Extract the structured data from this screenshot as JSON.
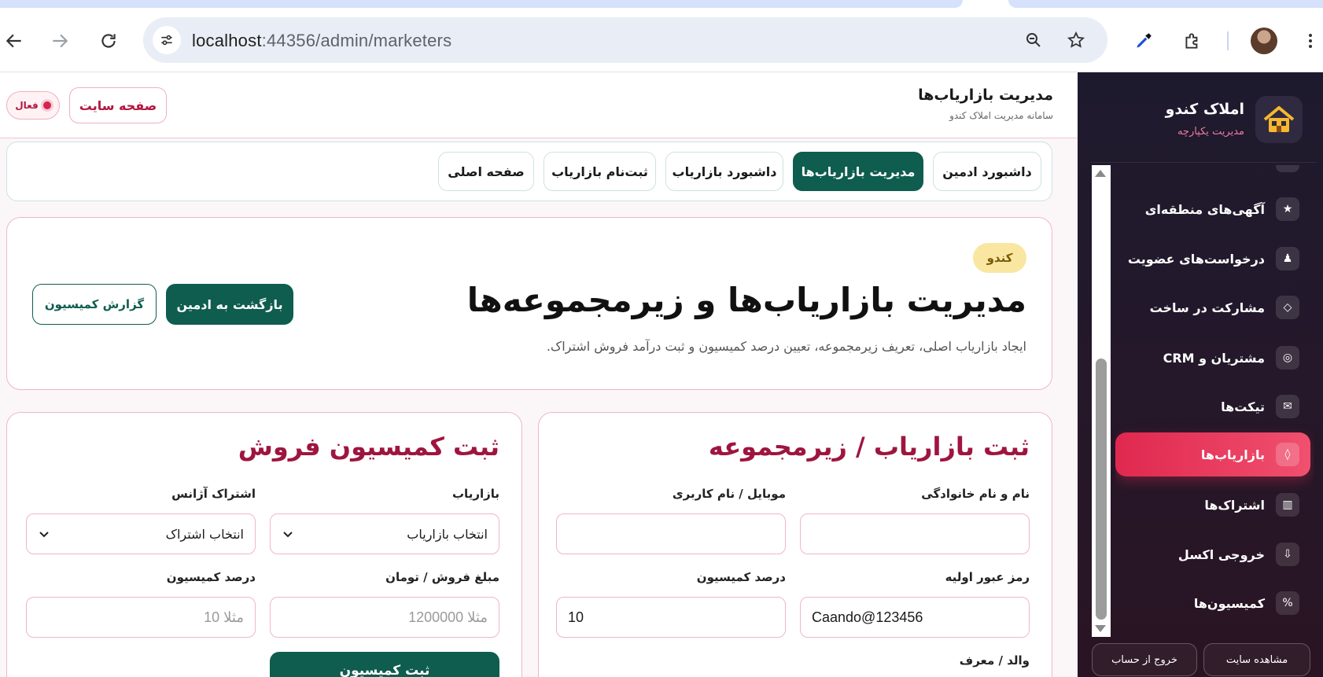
{
  "browser": {
    "url_host": "localhost",
    "url_rest": ":44356/admin/marketers"
  },
  "header": {
    "title": "مدیریت بازاریاب‌ها",
    "subtitle": "سامانه مدیریت املاک کندو",
    "site_button": "صفحه سایت",
    "status": "فعال"
  },
  "topnav": {
    "items": [
      {
        "label": "داشبورد ادمین"
      },
      {
        "label": "مدیریت بازاریاب‌ها"
      },
      {
        "label": "داشبورد بازاریاب"
      },
      {
        "label": "ثبت‌نام بازاریاب"
      },
      {
        "label": "صفحه اصلی"
      }
    ]
  },
  "hero": {
    "badge": "کندو",
    "title": "مدیریت بازاریاب‌ها و زیرمجموعه‌ها",
    "description": "ایجاد بازاریاب اصلی، تعریف زیرمجموعه، تعیین درصد کمیسیون و ثبت درآمد فروش اشتراک.",
    "back_button": "بازگشت به ادمین",
    "report_button": "گزارش کمیسیون"
  },
  "register_form": {
    "title": "ثبت بازاریاب / زیرمجموعه",
    "fullname_label": "نام و نام خانوادگی",
    "fullname_value": "",
    "mobile_label": "موبایل / نام کاربری",
    "mobile_value": "",
    "password_label": "رمز عبور اولیه",
    "password_value": "Caando@123456",
    "commission_label": "درصد کمیسیون",
    "commission_value": "10",
    "parent_label": "والد / معرف"
  },
  "commission_form": {
    "title": "ثبت کمیسیون فروش",
    "marketer_label": "بازاریاب",
    "marketer_value": "انتخاب بازاریاب",
    "subscription_label": "اشتراک آژانس",
    "subscription_value": "انتخاب اشتراک",
    "amount_label": "مبلغ فروش / تومان",
    "amount_placeholder": "مثلا 1200000",
    "percent_label": "درصد کمیسیون",
    "percent_placeholder": "مثلا 10",
    "submit": "ثبت کمیسیون"
  },
  "sidebar": {
    "brand_title": "املاک کندو",
    "brand_subtitle": "مدیریت یکپارچه",
    "partial_item": "...",
    "items": [
      {
        "label": "آگهی‌های منطقه‌ای",
        "icon": "star-icon",
        "glyph": "★"
      },
      {
        "label": "درخواست‌های عضویت",
        "icon": "person-icon",
        "glyph": "♟"
      },
      {
        "label": "مشارکت در ساخت",
        "icon": "diamond-icon",
        "glyph": "◇"
      },
      {
        "label": "مشتریان و CRM",
        "icon": "target-icon",
        "glyph": "◎"
      },
      {
        "label": "تیکت‌ها",
        "icon": "mail-icon",
        "glyph": "✉"
      },
      {
        "label": "بازاریاب‌ها",
        "icon": "diamond-small-icon",
        "glyph": "◊"
      },
      {
        "label": "اشتراک‌ها",
        "icon": "columns-icon",
        "glyph": "▥"
      },
      {
        "label": "خروجی اکسل",
        "icon": "download-icon",
        "glyph": "⇩"
      },
      {
        "label": "کمیسیون‌ها",
        "icon": "percent-icon",
        "glyph": "%"
      }
    ],
    "view_site": "مشاهده سایت",
    "logout": "خروج از حساب"
  },
  "colors": {
    "primary_green": "#0e5d4f",
    "accent_red": "#e0284f",
    "title_maroon": "#9e1540",
    "sidebar_bg": "#1e1a2e"
  }
}
